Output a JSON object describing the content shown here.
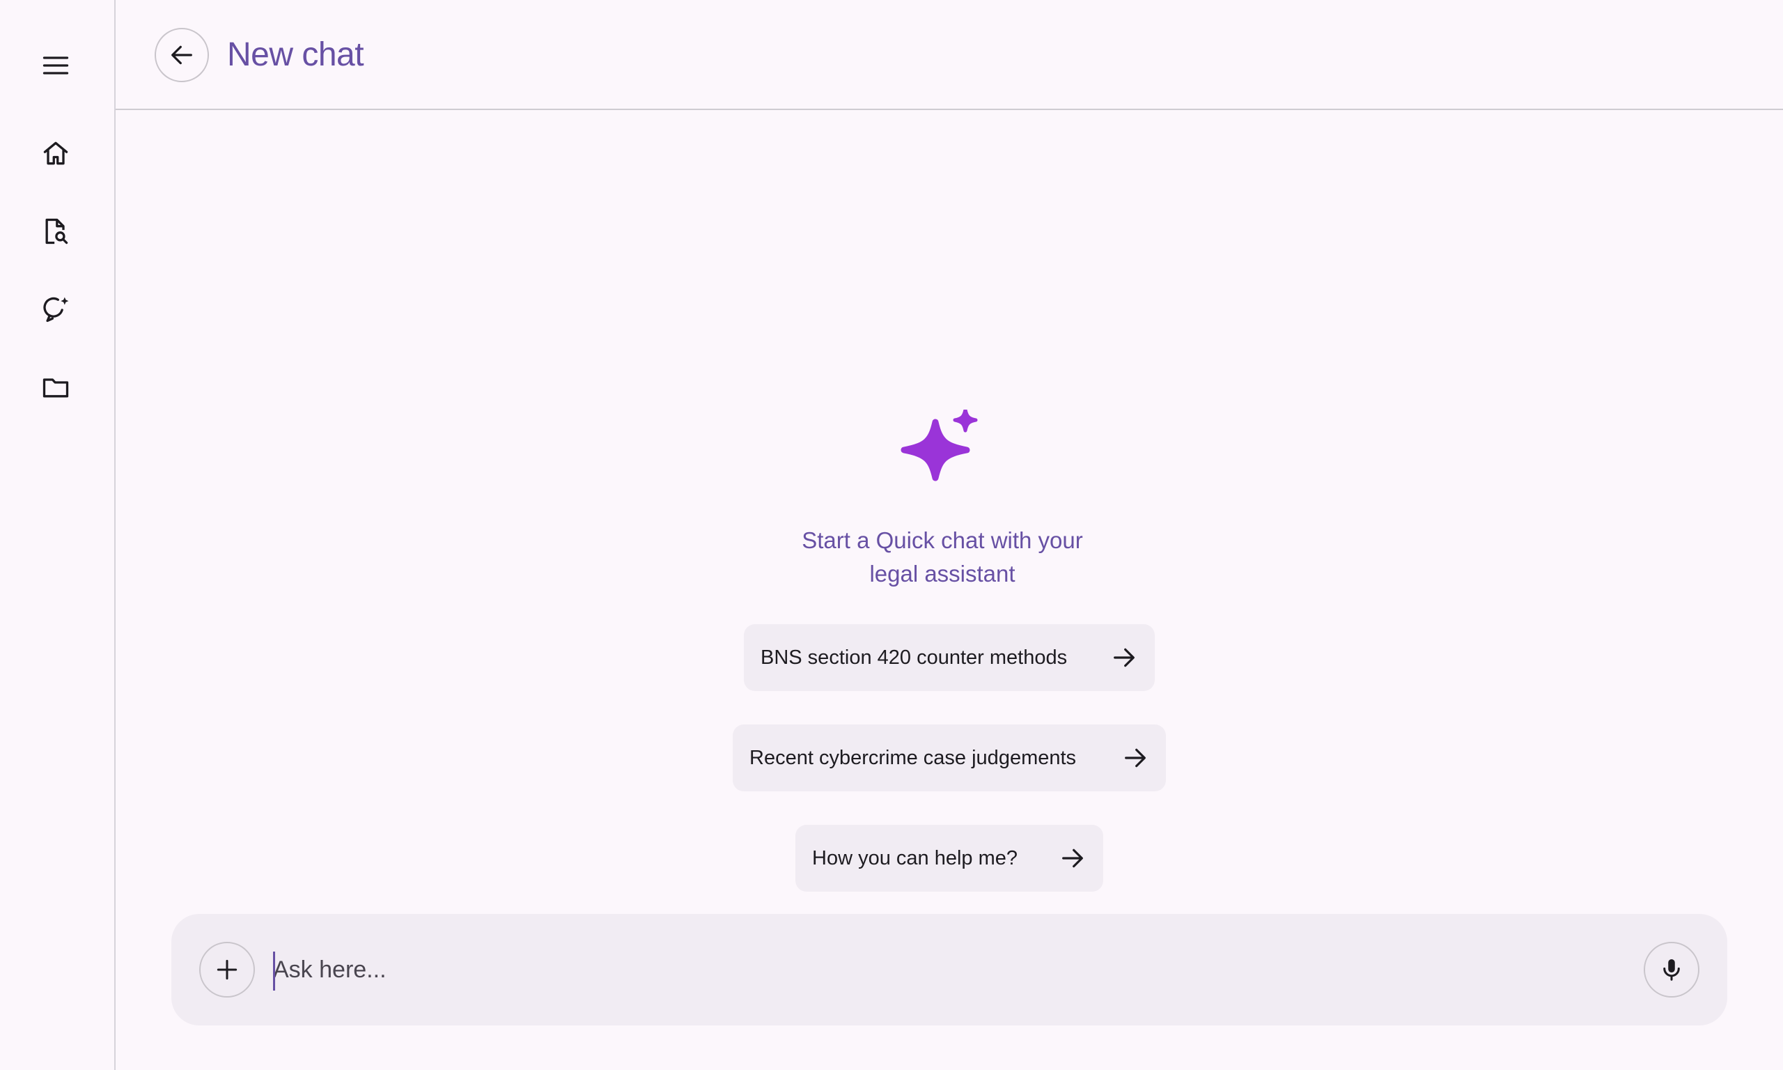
{
  "header": {
    "title": "New chat"
  },
  "hero": {
    "text": "Start a Quick chat with your legal assistant"
  },
  "suggestions": [
    {
      "label": "BNS section 420 counter methods"
    },
    {
      "label": "Recent cybercrime case judgements"
    },
    {
      "label": "How you can help me?"
    }
  ],
  "composer": {
    "placeholder": "Ask here...",
    "value": ""
  },
  "icons": {
    "rail": [
      "menu-icon",
      "home-icon",
      "document-search-icon",
      "chat-sparkle-icon",
      "folder-icon"
    ],
    "back": "arrow-left-icon",
    "hero": "sparkle-icon",
    "suggestion_arrow": "arrow-right-icon",
    "add": "plus-icon",
    "mic": "mic-icon"
  },
  "colors": {
    "accent": "#6750a4",
    "sparkle": "#9a34d8",
    "background": "#fcf7fc",
    "surface": "#f1ecf3"
  }
}
